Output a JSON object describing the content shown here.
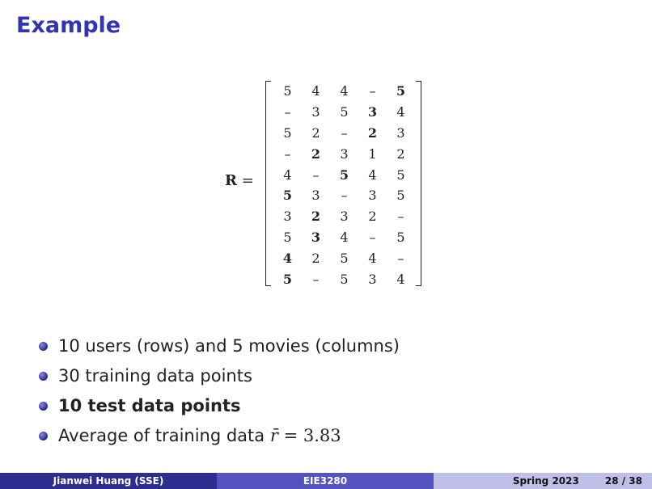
{
  "slide": {
    "title": "Example"
  },
  "matrix": {
    "label": "R",
    "rows": [
      [
        {
          "v": "5",
          "b": false
        },
        {
          "v": "4",
          "b": false
        },
        {
          "v": "4",
          "b": false
        },
        {
          "v": "–",
          "b": false
        },
        {
          "v": "5",
          "b": true
        }
      ],
      [
        {
          "v": "–",
          "b": false
        },
        {
          "v": "3",
          "b": false
        },
        {
          "v": "5",
          "b": false
        },
        {
          "v": "3",
          "b": true
        },
        {
          "v": "4",
          "b": false
        }
      ],
      [
        {
          "v": "5",
          "b": false
        },
        {
          "v": "2",
          "b": false
        },
        {
          "v": "–",
          "b": false
        },
        {
          "v": "2",
          "b": true
        },
        {
          "v": "3",
          "b": false
        }
      ],
      [
        {
          "v": "–",
          "b": false
        },
        {
          "v": "2",
          "b": true
        },
        {
          "v": "3",
          "b": false
        },
        {
          "v": "1",
          "b": false
        },
        {
          "v": "2",
          "b": false
        }
      ],
      [
        {
          "v": "4",
          "b": false
        },
        {
          "v": "–",
          "b": false
        },
        {
          "v": "5",
          "b": true
        },
        {
          "v": "4",
          "b": false
        },
        {
          "v": "5",
          "b": false
        }
      ],
      [
        {
          "v": "5",
          "b": true
        },
        {
          "v": "3",
          "b": false
        },
        {
          "v": "–",
          "b": false
        },
        {
          "v": "3",
          "b": false
        },
        {
          "v": "5",
          "b": false
        }
      ],
      [
        {
          "v": "3",
          "b": false
        },
        {
          "v": "2",
          "b": true
        },
        {
          "v": "3",
          "b": false
        },
        {
          "v": "2",
          "b": false
        },
        {
          "v": "–",
          "b": false
        }
      ],
      [
        {
          "v": "5",
          "b": false
        },
        {
          "v": "3",
          "b": true
        },
        {
          "v": "4",
          "b": false
        },
        {
          "v": "–",
          "b": false
        },
        {
          "v": "5",
          "b": false
        }
      ],
      [
        {
          "v": "4",
          "b": true
        },
        {
          "v": "2",
          "b": false
        },
        {
          "v": "5",
          "b": false
        },
        {
          "v": "4",
          "b": false
        },
        {
          "v": "–",
          "b": false
        }
      ],
      [
        {
          "v": "5",
          "b": true
        },
        {
          "v": "–",
          "b": false
        },
        {
          "v": "5",
          "b": false
        },
        {
          "v": "3",
          "b": false
        },
        {
          "v": "4",
          "b": false
        }
      ]
    ]
  },
  "bullets": {
    "b1": "10 users (rows) and 5 movies (columns)",
    "b2": "30 training data points",
    "b3": "10 test data points",
    "b4_text": "Average of training data ",
    "b4_symbol": "r̄",
    "b4_equals": " = ",
    "b4_value": "3.83"
  },
  "footer": {
    "author": "Jianwei Huang  (SSE)",
    "course": "EIE3280",
    "term": "Spring 2023",
    "page": "28 / 38"
  },
  "colors": {
    "title": "#3333b3",
    "footer_dark": "#2d2d8f",
    "footer_mid": "#5454c0",
    "footer_light": "#bfbfe8"
  }
}
